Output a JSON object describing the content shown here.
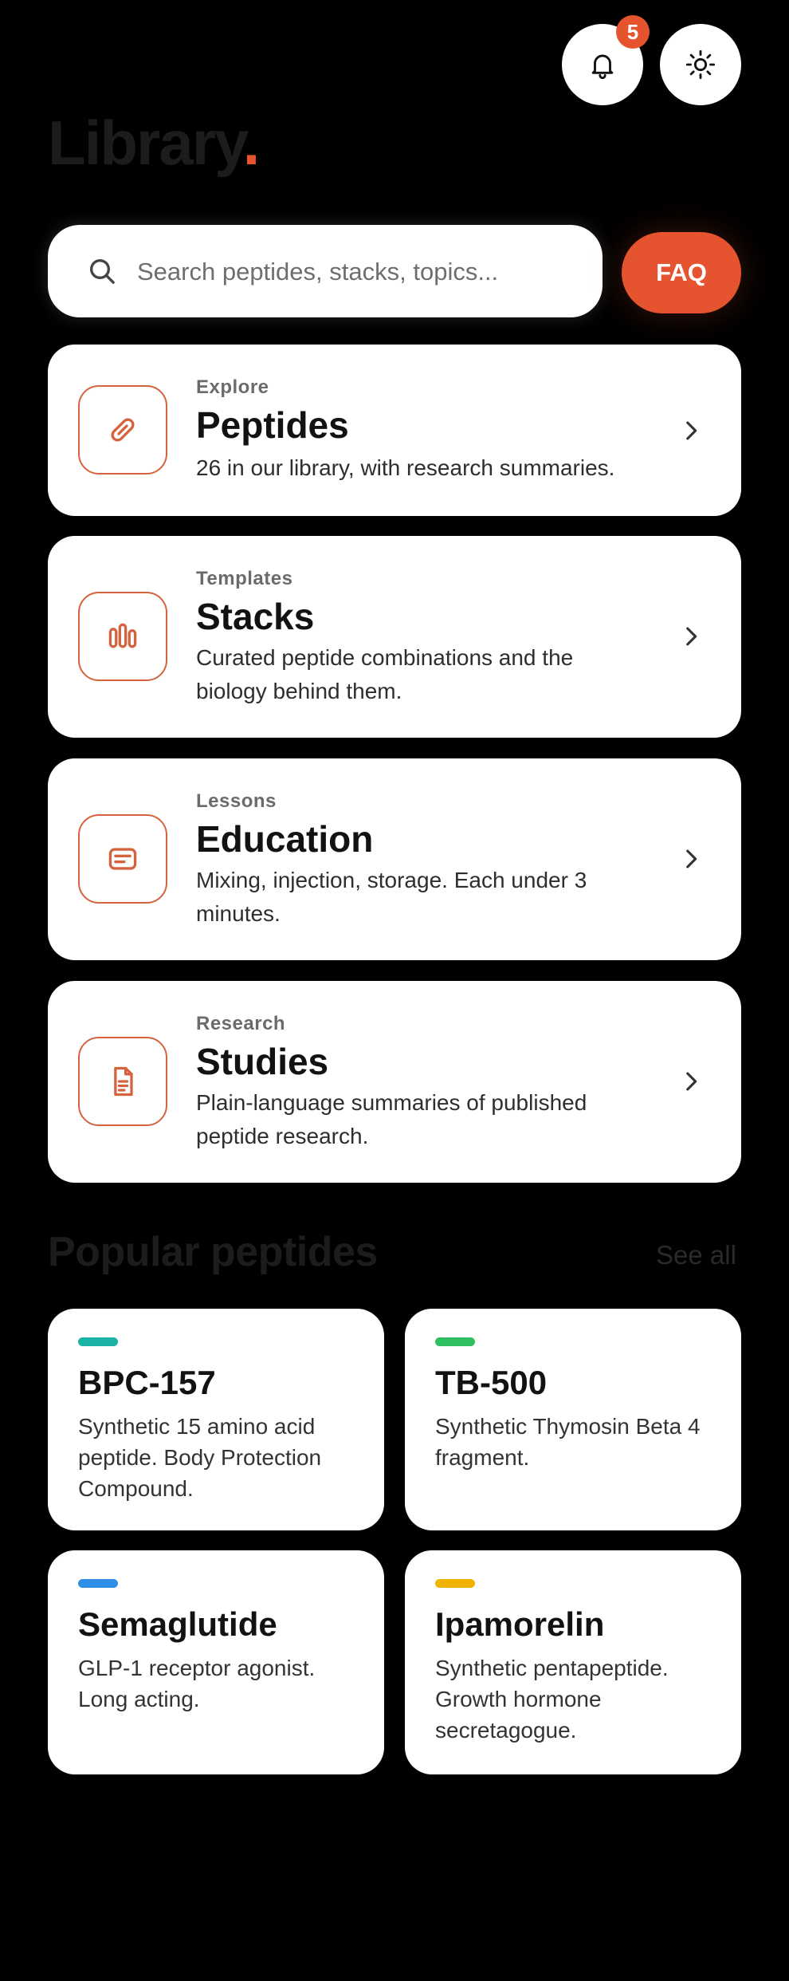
{
  "header": {
    "notifications_count": "5",
    "title": "Library",
    "title_dot": "."
  },
  "search": {
    "placeholder": "Search peptides, stacks, topics...",
    "faq_label": "FAQ"
  },
  "sections": [
    {
      "kicker": "Explore",
      "title": "Peptides",
      "desc": "26 in our library, with research summaries.",
      "icon": "pill-icon"
    },
    {
      "kicker": "Templates",
      "title": "Stacks",
      "desc": "Curated peptide combinations and the biology behind them.",
      "icon": "vials-icon"
    },
    {
      "kicker": "Lessons",
      "title": "Education",
      "desc": "Mixing, injection, storage. Each under 3 minutes.",
      "icon": "message-icon"
    },
    {
      "kicker": "Research",
      "title": "Studies",
      "desc": "Plain-language summaries of published peptide research.",
      "icon": "document-icon"
    }
  ],
  "popular": {
    "title": "Popular peptides",
    "see_all": "See all",
    "items": [
      {
        "name": "BPC-157",
        "desc": "Synthetic 15 amino acid peptide. Body Protection Compound.",
        "color": "#1ab3a6"
      },
      {
        "name": "TB-500",
        "desc": "Synthetic Thymosin Beta 4 fragment.",
        "color": "#2fbf5e"
      },
      {
        "name": "Semaglutide",
        "desc": "GLP-1 receptor agonist. Long acting.",
        "color": "#2e8fe6"
      },
      {
        "name": "Ipamorelin",
        "desc": "Synthetic pentapeptide. Growth hormone secretagogue.",
        "color": "#f0b400"
      }
    ]
  },
  "colors": {
    "accent": "#e5532f",
    "icon_stroke": "#d4633e",
    "background": "#000000",
    "card": "#ffffff"
  }
}
